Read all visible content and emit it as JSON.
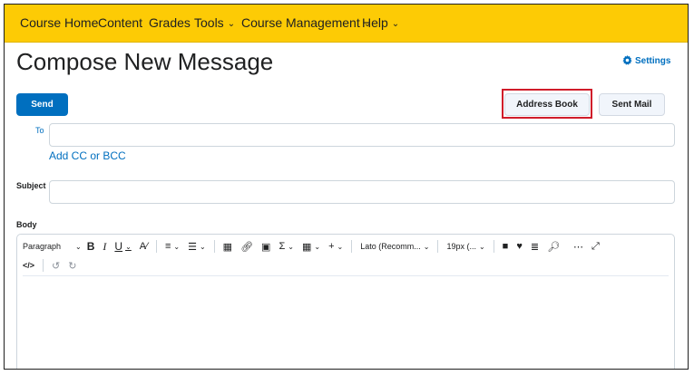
{
  "nav": {
    "items": [
      {
        "label": "Course Home",
        "dropdown": false
      },
      {
        "label": "Content",
        "dropdown": false
      },
      {
        "label": "Grades",
        "dropdown": false
      },
      {
        "label": "Tools",
        "dropdown": true
      },
      {
        "label": "Course Management",
        "dropdown": true
      },
      {
        "label": "Help",
        "dropdown": true
      }
    ]
  },
  "page": {
    "title": "Compose New Message",
    "settings_label": "Settings"
  },
  "actions": {
    "send_label": "Send",
    "address_book_label": "Address Book",
    "sent_mail_label": "Sent Mail"
  },
  "form": {
    "to_label": "To",
    "to_value": "",
    "add_cc_bcc_label": "Add CC or BCC",
    "subject_label": "Subject",
    "subject_value": "",
    "body_label": "Body"
  },
  "editor": {
    "format_select": "Paragraph",
    "font_select": "Lato (Recomm...",
    "size_select": "19px (..."
  },
  "colors": {
    "nav_bg": "#fdcb05",
    "primary": "#006fbf",
    "highlight": "#d01c2a"
  }
}
